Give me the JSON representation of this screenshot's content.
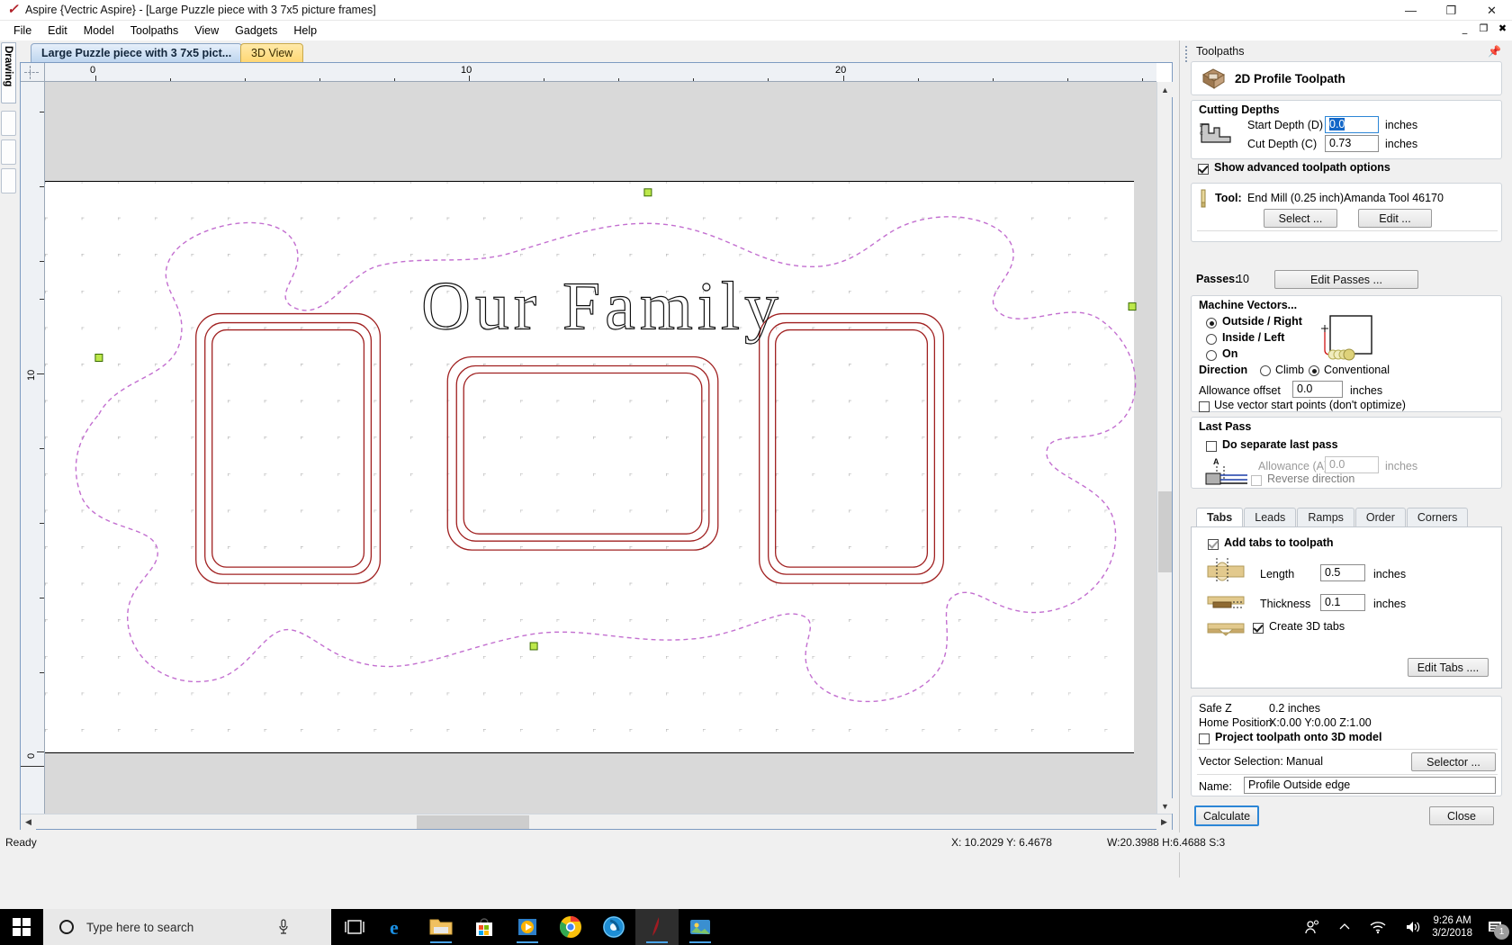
{
  "window": {
    "title": "Aspire {Vectric Aspire} - [Large Puzzle piece with 3 7x5 picture frames]",
    "app_icon": "aspire-logo-icon",
    "minimize": "—",
    "maximize": "❐",
    "close": "✕",
    "mdi_minimize": "_",
    "mdi_restore": "❐",
    "mdi_close": "✖"
  },
  "menu": {
    "items": [
      {
        "label": "File"
      },
      {
        "label": "Edit"
      },
      {
        "label": "Model"
      },
      {
        "label": "Toolpaths"
      },
      {
        "label": "View"
      },
      {
        "label": "Gadgets"
      },
      {
        "label": "Help"
      }
    ]
  },
  "left_rail": {
    "drawing_tab": "Drawing"
  },
  "doc_tabs": {
    "active": "Large Puzzle piece with 3 7x5 pict...",
    "view3d": "3D View"
  },
  "canvas": {
    "h_ruler_labels": [
      "0",
      "10",
      "20"
    ],
    "v_ruler_labels": [
      "10",
      "0"
    ],
    "artwork_text": "Our Family",
    "frame_count": 3,
    "puzzle_outline_color": "#c36fd0",
    "frame_color": "#a02020"
  },
  "panel": {
    "title": "Toolpaths",
    "pin_icon": "pin-icon",
    "header": {
      "icon": "2d-profile-toolpath-icon",
      "label": "2D Profile Toolpath"
    },
    "cutting_depths": {
      "group_label": "Cutting Depths",
      "icon": "cut-depth-diagram-icon",
      "start_depth_label": "Start Depth (D)",
      "start_depth_value": "0.0",
      "start_depth_units": "inches",
      "cut_depth_label": "Cut Depth (C)",
      "cut_depth_value": "0.73",
      "cut_depth_units": "inches",
      "show_advanced_label": "Show advanced toolpath options",
      "show_advanced_checked": true
    },
    "tool": {
      "icon": "end-mill-icon",
      "label": "Tool:",
      "value": "End Mill (0.25 inch)Amanda Tool 46170",
      "select_button": "Select ...",
      "edit_button": "Edit ...",
      "passes_label": "Passes:",
      "passes_value": "10",
      "edit_passes_button": "Edit Passes ..."
    },
    "machine_vectors": {
      "group_label": "Machine Vectors...",
      "options": [
        {
          "label": "Outside / Right",
          "selected": true
        },
        {
          "label": "Inside / Left",
          "selected": false
        },
        {
          "label": "On",
          "selected": false
        }
      ],
      "direction_label": "Direction",
      "direction_options": [
        {
          "label": "Climb",
          "selected": false
        },
        {
          "label": "Conventional",
          "selected": true
        }
      ],
      "allowance_offset_label": "Allowance offset",
      "allowance_offset_value": "0.0",
      "allowance_offset_units": "inches",
      "use_vector_start_label": "Use vector start points (don't optimize)",
      "use_vector_start_checked": false,
      "preview_icon": "vector-offset-preview-icon"
    },
    "last_pass": {
      "group_label": "Last Pass",
      "do_separate_label": "Do separate last pass",
      "do_separate_checked": false,
      "allowance_label": "Allowance (A)",
      "allowance_value": "0.0",
      "allowance_units": "inches",
      "reverse_direction_label": "Reverse direction",
      "reverse_direction_checked": false,
      "icon": "last-pass-diagram-icon",
      "icon_letter": "A"
    },
    "option_tabs": {
      "items": [
        "Tabs",
        "Leads",
        "Ramps",
        "Order",
        "Corners"
      ],
      "active": "Tabs"
    },
    "tabs_panel": {
      "add_tabs_label": "Add tabs to toolpath",
      "add_tabs_checked": true,
      "length_label": "Length",
      "length_value": "0.5",
      "length_units": "inches",
      "length_icon": "tab-length-icon",
      "thickness_label": "Thickness",
      "thickness_value": "0.1",
      "thickness_units": "inches",
      "thickness_icon": "tab-thickness-icon",
      "create_3d_label": "Create 3D tabs",
      "create_3d_checked": true,
      "create_3d_icon": "tab-3d-icon",
      "edit_tabs_button": "Edit Tabs ...."
    },
    "footer": {
      "safe_z_label": "Safe Z",
      "safe_z_value": "0.2 inches",
      "home_position_label": "Home Position",
      "home_position_value": "X:0.00 Y:0.00 Z:1.00",
      "project_label": "Project toolpath onto 3D model",
      "project_checked": false,
      "vector_selection_label": "Vector Selection:",
      "vector_selection_value": "Manual",
      "selector_button": "Selector ...",
      "name_label": "Name:",
      "name_value": "Profile Outside edge"
    },
    "actions": {
      "calculate": "Calculate",
      "close": "Close"
    }
  },
  "status_bar": {
    "ready": "Ready",
    "cursor": "X: 10.2029 Y:  6.4678",
    "dimensions": "W:20.3988  H:6.4688  S:3"
  },
  "taskbar": {
    "start_icon": "windows-start-icon",
    "search_placeholder": "Type here to search",
    "search_icon": "search-circle-icon",
    "mic_icon": "microphone-icon",
    "items": [
      {
        "icon": "task-view-icon",
        "name": "task-view"
      },
      {
        "icon": "edge-icon",
        "name": "microsoft-edge"
      },
      {
        "icon": "file-explorer-icon",
        "name": "file-explorer"
      },
      {
        "icon": "microsoft-store-icon",
        "name": "microsoft-store"
      },
      {
        "icon": "media-player-icon",
        "name": "media-player"
      },
      {
        "icon": "chrome-icon",
        "name": "google-chrome"
      },
      {
        "icon": "disc-icon",
        "name": "disc-app"
      },
      {
        "icon": "aspire-icon",
        "name": "vectric-aspire"
      },
      {
        "icon": "photos-icon",
        "name": "photos-app"
      }
    ],
    "tray": {
      "people_icon": "people-icon",
      "chevron_icon": "chevron-up-icon",
      "wifi_icon": "wifi-icon",
      "volume_icon": "volume-icon",
      "time": "9:26 AM",
      "date": "3/2/2018",
      "notification_icon": "notification-icon",
      "notification_count": "1"
    }
  }
}
